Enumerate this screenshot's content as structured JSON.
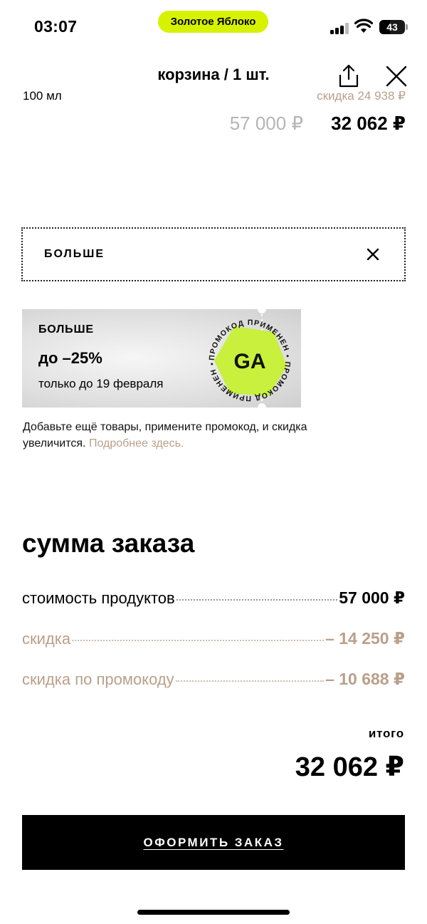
{
  "status_bar": {
    "time": "03:07",
    "app_pill": "Золотое Яблоко",
    "battery": "43",
    "battery_level_percent": 43,
    "icons": [
      "signal-icon",
      "wifi-icon",
      "battery-icon"
    ]
  },
  "header": {
    "title": "корзина / 1 шт.",
    "share_icon": "share-icon",
    "close_icon": "close-icon"
  },
  "product": {
    "volume": "100 мл",
    "discount": "скидка 24 938 ₽",
    "old_price": "57 000 ₽",
    "new_price": "32 062 ₽"
  },
  "promo": {
    "code": "БОЛЬШЕ",
    "remove_icon": "close-icon"
  },
  "banner": {
    "code": "БОЛЬШЕ",
    "discount": "до –25%",
    "date": "только до 19 февраля",
    "badge_logo": "GA",
    "badge_ring_text": "ПРОМОКОД ПРИМЕНЕН • ПРОМОКОД ПРИМЕНЕН •",
    "badge_color": "#c8f03c"
  },
  "promo_note": {
    "text": "Добавьте ещё товары, примените промокод, и скидка увеличится. ",
    "link": "Подробнее здесь."
  },
  "summary": {
    "title": "сумма заказа",
    "rows": [
      {
        "label": "стоимость продуктов",
        "value": "57 000 ₽"
      },
      {
        "label": "скидка",
        "value": "– 14 250 ₽"
      },
      {
        "label": "скидка по промокоду",
        "value": "– 10 688 ₽"
      }
    ],
    "total_label": "итого",
    "total_value": "32 062 ₽"
  },
  "checkout": {
    "label": "ОФОРМИТЬ ЗАКАЗ"
  },
  "colors": {
    "accent_lime": "#d7f200",
    "discount_tan": "#b9a08a",
    "muted_gray": "#b5b5b5"
  }
}
